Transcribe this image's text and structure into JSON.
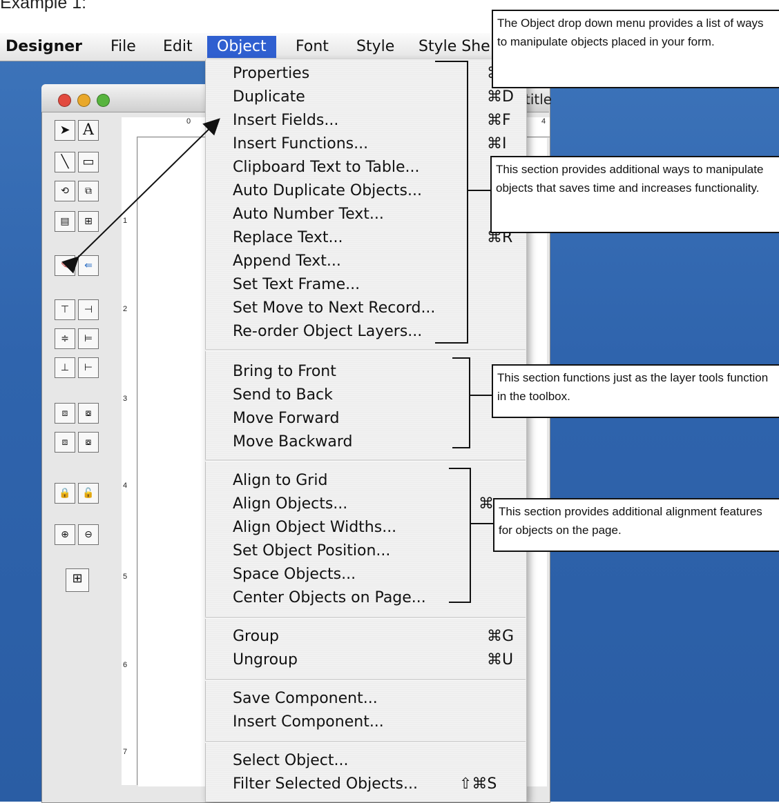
{
  "heading": "Example 1:",
  "menubar": {
    "app": "Designer",
    "items": [
      "File",
      "Edit",
      "Object",
      "Font",
      "Style",
      "Style She"
    ]
  },
  "window": {
    "title_fragment": "title"
  },
  "menu": {
    "items": [
      {
        "label": "Properties",
        "shortcut": "⌘"
      },
      {
        "label": "Duplicate",
        "shortcut": "⌘D"
      },
      {
        "label": "Insert Fields...",
        "shortcut": "⌘F"
      },
      {
        "label": "Insert Functions...",
        "shortcut": "⌘I"
      },
      {
        "label": "Clipboard Text to Table...",
        "shortcut": ""
      },
      {
        "label": "Auto Duplicate Objects...",
        "shortcut": ""
      },
      {
        "label": "Auto Number Text...",
        "shortcut": ""
      },
      {
        "label": "Replace Text...",
        "shortcut": "⌘R"
      },
      {
        "label": "Append Text...",
        "shortcut": ""
      },
      {
        "label": "Set Text Frame...",
        "shortcut": ""
      },
      {
        "label": "Set Move to Next Record...",
        "shortcut": ""
      },
      {
        "label": "Re-order Object Layers...",
        "shortcut": ""
      },
      {
        "label": "Bring to Front",
        "shortcut": ""
      },
      {
        "label": "Send to Back",
        "shortcut": ""
      },
      {
        "label": "Move Forward",
        "shortcut": ""
      },
      {
        "label": "Move Backward",
        "shortcut": ""
      },
      {
        "label": "Align to Grid",
        "shortcut": ""
      },
      {
        "label": "Align Objects...",
        "shortcut": "⌘"
      },
      {
        "label": "Align Object Widths...",
        "shortcut": ""
      },
      {
        "label": "Set Object Position...",
        "shortcut": ""
      },
      {
        "label": "Space Objects...",
        "shortcut": ""
      },
      {
        "label": "Center Objects on Page...",
        "shortcut": ""
      },
      {
        "label": "Group",
        "shortcut": "⌘G"
      },
      {
        "label": "Ungroup",
        "shortcut": "⌘U"
      },
      {
        "label": "Save Component...",
        "shortcut": ""
      },
      {
        "label": "Insert Component...",
        "shortcut": ""
      },
      {
        "label": "Select Object...",
        "shortcut": ""
      },
      {
        "label": "Filter Selected Objects...",
        "shortcut": "⇧⌘S"
      }
    ]
  },
  "ruler": {
    "h_labels": [
      "0",
      "4"
    ],
    "v_labels": [
      "1",
      "2",
      "3",
      "4",
      "5",
      "6",
      "7"
    ]
  },
  "callouts": {
    "object_menu": "The Object drop down menu provides a list of ways to manipulate objects placed in your form.",
    "section1": "This section provides additional ways to manipulate objects that saves time and increases functionality.",
    "section2": "This section functions just as the layer tools function in the toolbox.",
    "section3": "This section provides additional alignment features for objects on the page."
  },
  "colors": {
    "menu_highlight": "#2f5fd0",
    "desktop": "#3c73b9"
  }
}
